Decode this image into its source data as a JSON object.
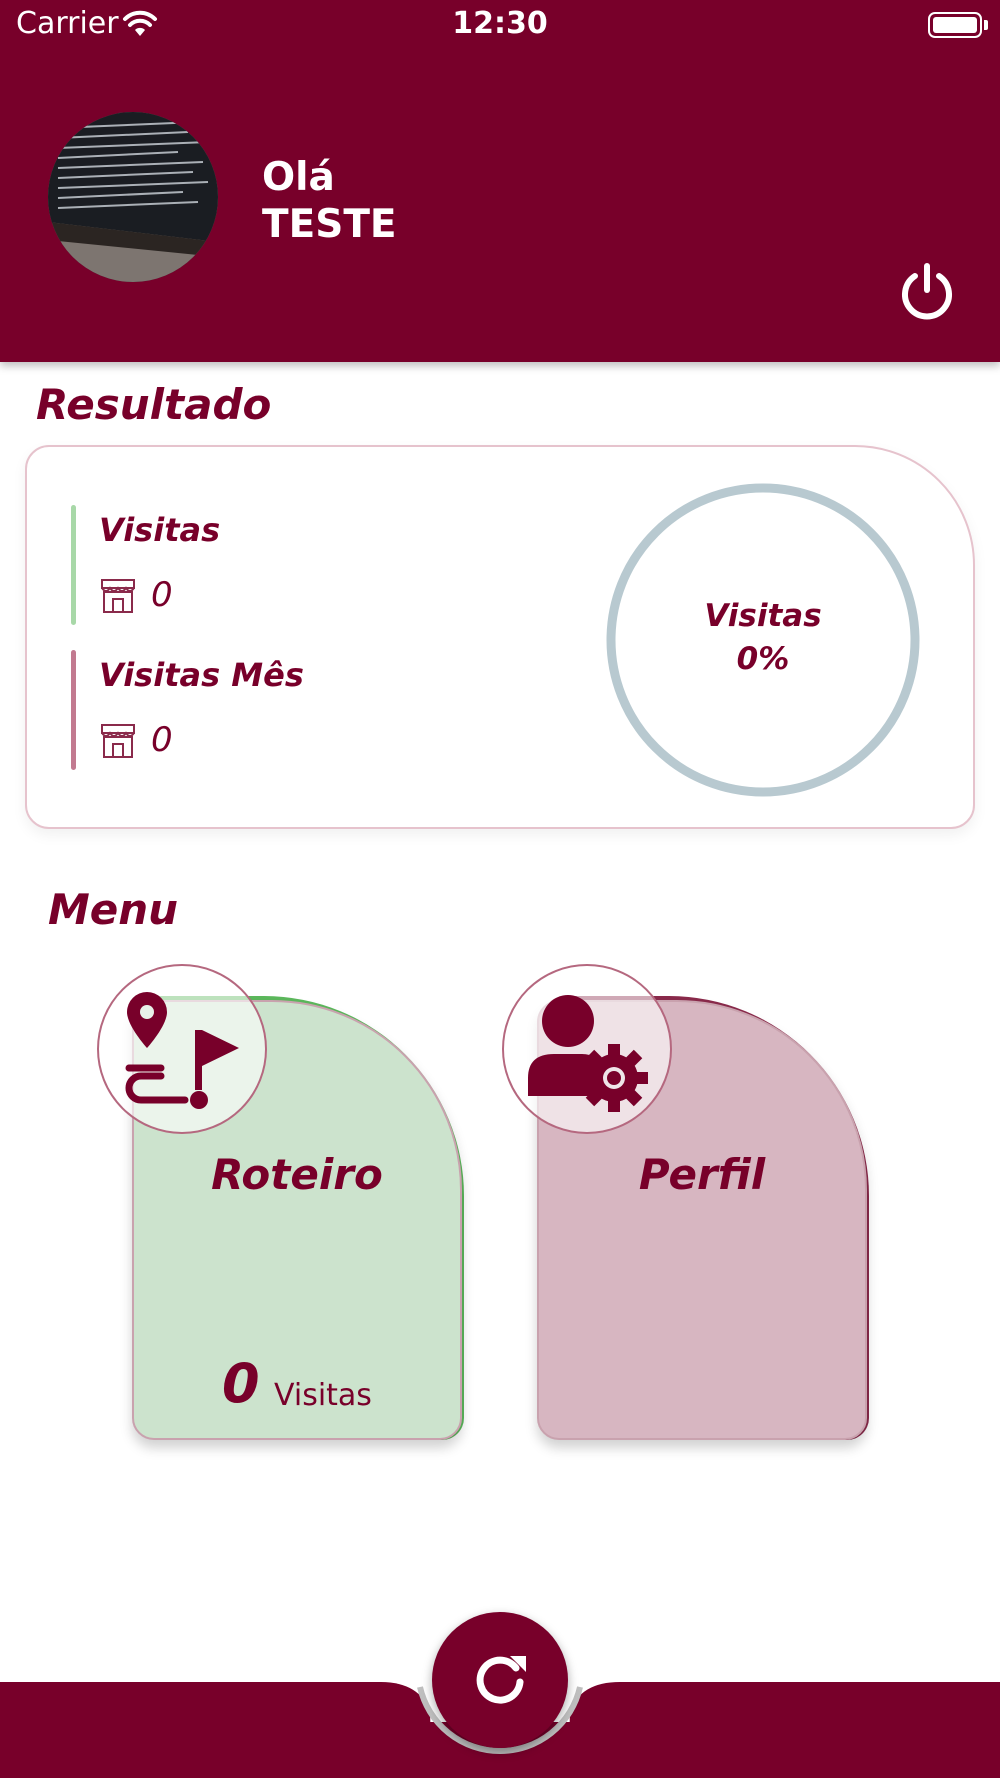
{
  "status_bar": {
    "carrier": "Carrier",
    "time": "12:30"
  },
  "header": {
    "greeting": "Olá",
    "user_name": "TESTE"
  },
  "resultado": {
    "title": "Resultado",
    "stats": [
      {
        "label": "Visitas",
        "value": "0",
        "color": "#a8d8a8"
      },
      {
        "label": "Visitas Mês",
        "value": "0",
        "color": "#c27a90"
      }
    ],
    "ring": {
      "label": "Visitas",
      "percent_text": "0%",
      "percent": 0,
      "track_color": "#b8c9d0"
    }
  },
  "menu": {
    "title": "Menu",
    "tiles": [
      {
        "label": "Roteiro",
        "count": "0",
        "count_label": "Visitas",
        "color": "#cce3cd",
        "accent": "#5cb85c"
      },
      {
        "label": "Perfil",
        "color": "#d7b6c1",
        "accent": "#8a2a4b"
      }
    ]
  },
  "colors": {
    "primary": "#78002a",
    "background": "#ffffff"
  }
}
